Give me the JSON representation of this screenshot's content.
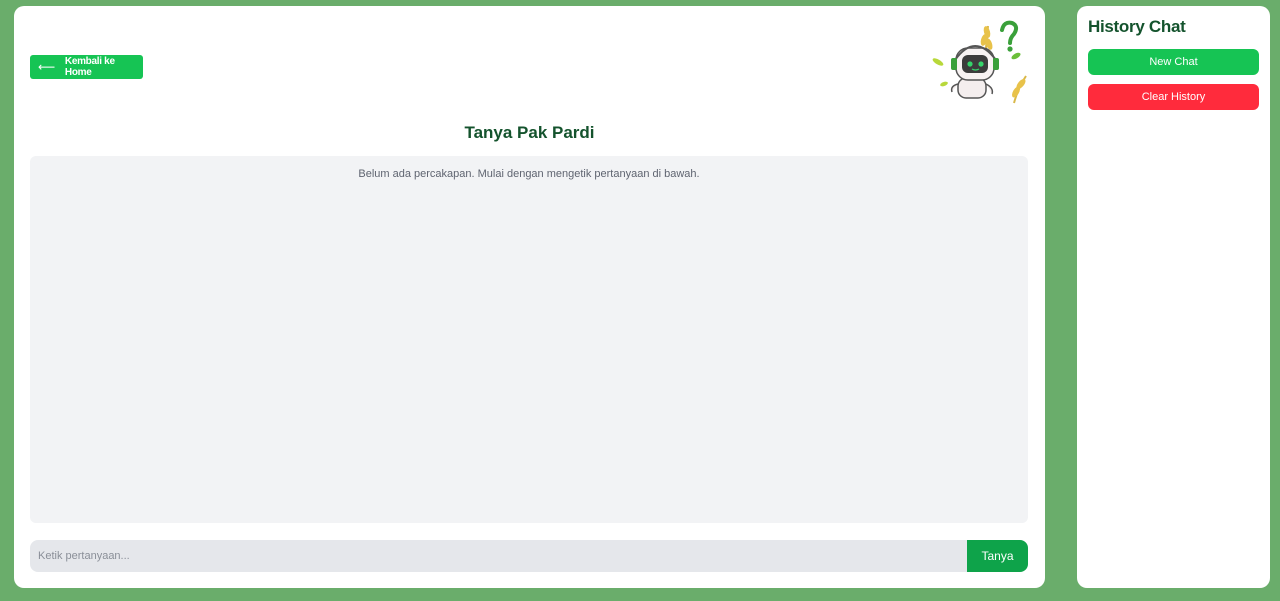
{
  "nav": {
    "back_label": "Kembali ke Home",
    "back_icon": "arrow-left-icon"
  },
  "mascot": {
    "icon": "robot-farmer-mascot-icon"
  },
  "main": {
    "title": "Tanya Pak Pardi",
    "empty_message": "Belum ada percakapan. Mulai dengan mengetik pertanyaan di bawah.",
    "input_placeholder": "Ketik pertanyaan...",
    "input_value": "",
    "ask_label": "Tanya"
  },
  "sidebar": {
    "title": "History Chat",
    "new_chat_label": "New Chat",
    "clear_history_label": "Clear History"
  },
  "colors": {
    "background": "#6aad6b",
    "primary_green": "#16c454",
    "dark_green_text": "#14532d",
    "danger_red": "#ff2b3c",
    "chat_area": "#f2f3f5"
  }
}
